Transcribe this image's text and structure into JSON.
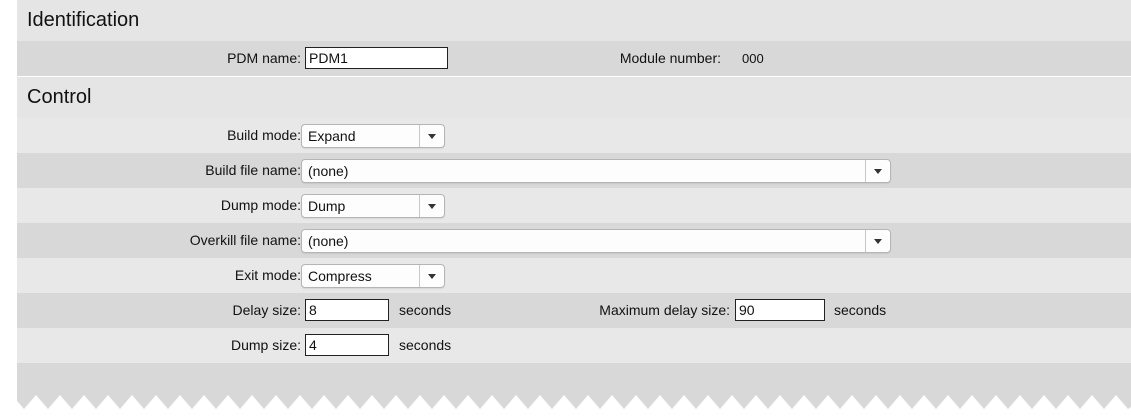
{
  "identification": {
    "title": "Identification",
    "pdm_name_label": "PDM name:",
    "pdm_name_value": "PDM1",
    "module_number_label": "Module number:",
    "module_number_value": "000"
  },
  "control": {
    "title": "Control",
    "build_mode_label": "Build mode:",
    "build_mode_value": "Expand",
    "build_file_label": "Build file name:",
    "build_file_value": "(none)",
    "dump_mode_label": "Dump mode:",
    "dump_mode_value": "Dump",
    "overkill_file_label": "Overkill file name:",
    "overkill_file_value": "(none)",
    "exit_mode_label": "Exit mode:",
    "exit_mode_value": "Compress",
    "delay_size_label": "Delay size:",
    "delay_size_value": "8",
    "delay_size_unit": "seconds",
    "max_delay_label": "Maximum delay size:",
    "max_delay_value": "90",
    "max_delay_unit": "seconds",
    "dump_size_label": "Dump size:",
    "dump_size_value": "4",
    "dump_size_unit": "seconds"
  },
  "icons": {
    "caret": "chevron-down-icon"
  }
}
